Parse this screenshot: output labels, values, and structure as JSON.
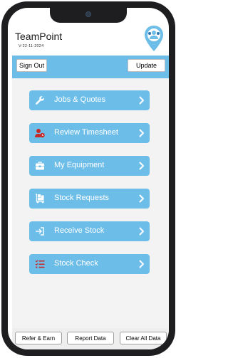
{
  "header": {
    "title": "TeamPoint",
    "version": "V-22-11-2024"
  },
  "toolbar": {
    "sign_out_label": "Sign Out",
    "update_label": "Update"
  },
  "menu": {
    "items": [
      {
        "label": "Jobs & Quotes",
        "icon": "wrench-icon"
      },
      {
        "label": "Review Timesheet",
        "icon": "user-clock-icon"
      },
      {
        "label": "My Equipment",
        "icon": "toolbox-icon"
      },
      {
        "label": "Stock Requests",
        "icon": "dolly-icon"
      },
      {
        "label": "Receive Stock",
        "icon": "sign-in-icon"
      },
      {
        "label": "Stock Check",
        "icon": "checklist-icon"
      }
    ]
  },
  "footer": {
    "refer_label": "Refer & Earn",
    "report_label": "Report Data",
    "clear_label": "Clear All Data"
  },
  "colors": {
    "accent": "#6dbde9",
    "icon_red": "#c62828",
    "background": "#f3f3f3"
  }
}
